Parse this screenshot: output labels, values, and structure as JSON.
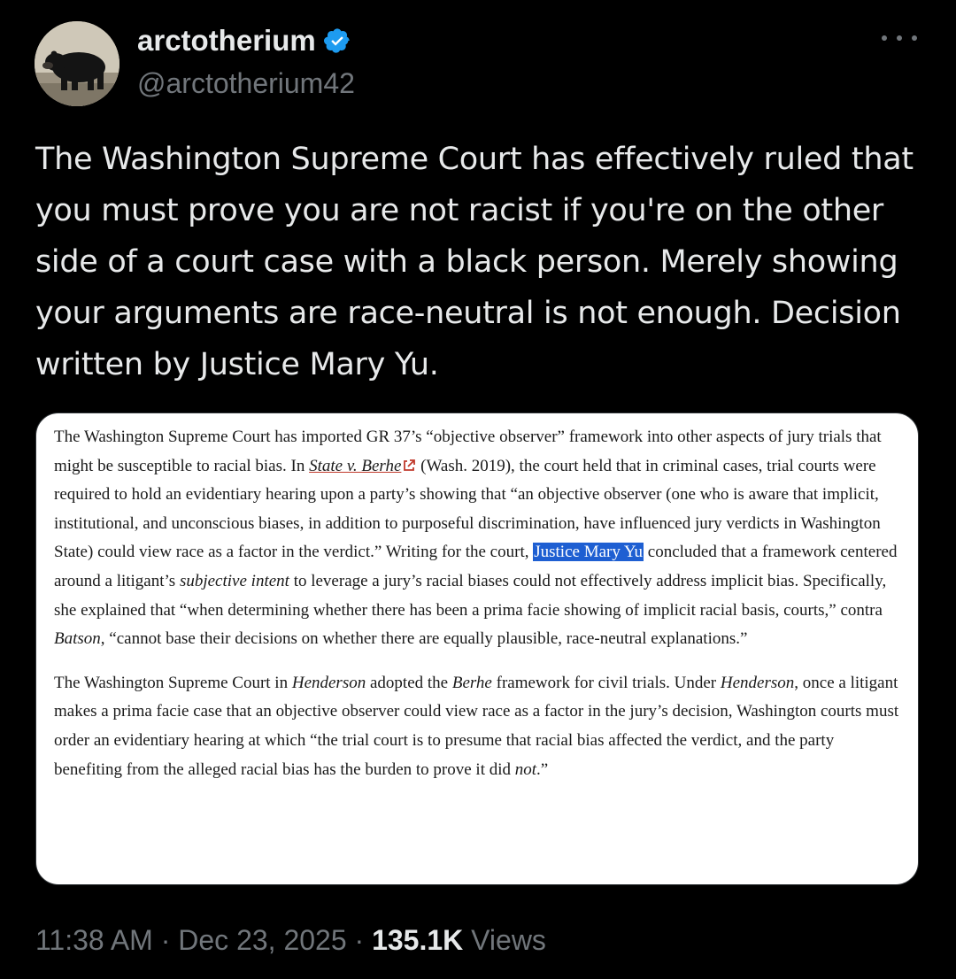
{
  "author": {
    "display_name": "arctotherium",
    "handle": "@arctotherium42",
    "verified_icon": "verified-badge-icon",
    "avatar": "bear-photo-avatar"
  },
  "tweet": {
    "text": "The Washington Supreme Court has effectively ruled that you must prove you are not racist if you're on the other side of a court case with a black person. Merely showing your arguments are race-neutral is not enough. Decision written by Justice Mary Yu."
  },
  "card": {
    "p1": {
      "s1": "The Washington Supreme Court has imported GR 37’s “objective observer” framework into other aspects of jury trials that might be susceptible to racial bias. In ",
      "link": "State v. Berhe",
      "s2": " (Wash. 2019), the court held that in criminal cases, trial courts were required to hold an evidentiary hearing upon a party’s showing that “an objective observer (one who is aware that implicit, institutional, and unconscious biases, in addition to purposeful discrimination, have influenced jury verdicts in Washington State) could view race as a factor in the verdict.” Writing for the court, ",
      "highlight": "Justice Mary Yu",
      "s3": " concluded that a framework centered around a litigant’s ",
      "i1": "subjective intent",
      "s4": " to leverage a jury’s racial biases could not effectively address implicit bias. Specifically, she explained that “when determining whether there has been a prima facie showing of implicit racial basis, courts,” contra ",
      "i2": "Batson",
      "s5": ", “cannot base their decisions on whether there are equally plausible, race-neutral explanations.”"
    },
    "p2": {
      "s1": "The Washington Supreme Court in ",
      "i1": "Henderson",
      "s2": " adopted the ",
      "i2": "Berhe",
      "s3": " framework for civil trials. Under ",
      "i3": "Henderson",
      "s4": ", once a litigant makes a prima facie case that an objective observer could view race as a factor in the jury’s decision, Washington courts must order an evidentiary hearing at which “the trial court is to presume that racial bias affected the verdict, and the party benefiting from the alleged racial bias has the burden to prove it did ",
      "i4": "not",
      "s5": ".”"
    }
  },
  "meta": {
    "time": "11:38 AM",
    "sep1": " · ",
    "date": "Dec 23, 2025",
    "sep2": " · ",
    "views_count": "135.1K",
    "views_label": " Views"
  },
  "colors": {
    "background": "#000000",
    "text": "#e7e9ea",
    "secondary": "#71767b",
    "verified": "#1d9bf0",
    "highlight": "#1e5fd2"
  }
}
